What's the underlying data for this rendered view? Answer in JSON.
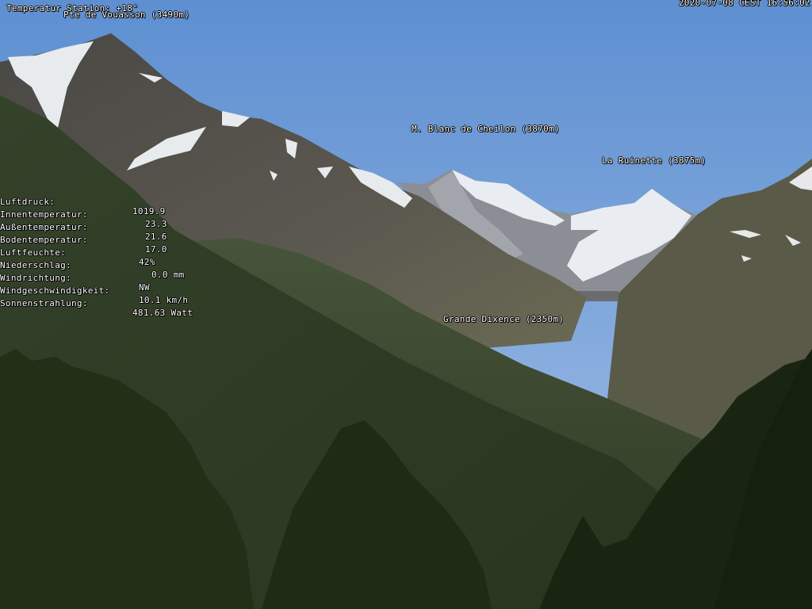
{
  "header": {
    "station_temp": "Temperatur Station: +18°",
    "timestamp": "2020-07-08 CEST 16:56:02"
  },
  "peaks": {
    "vouasson": "Pte de Vouasson (3490m)",
    "cheilon": "M. Blanc de Cheilon (3870m)",
    "ruinette": "La Ruinette (3875m)",
    "dixence": "Grande Dixence (2350m)"
  },
  "weather": [
    {
      "label": "Luftdruck:",
      "value": "1019.9"
    },
    {
      "label": "Innentemperatur:",
      "value": "23.3"
    },
    {
      "label": "Außentemperatur:",
      "value": "21.6"
    },
    {
      "label": "Bodentemperatur:",
      "value": "17.0"
    },
    {
      "label": "Luftfeuchte:",
      "value": "42%"
    },
    {
      "label": "Niederschlag:",
      "value": "0.0 mm"
    },
    {
      "label": "Windrichtung:",
      "value": "NW"
    },
    {
      "label": "Windgeschwindigkeit:",
      "value": "10.1 km/h"
    },
    {
      "label": "Sonnenstrahlung:",
      "value": "481.63 Watt"
    }
  ],
  "colors": {
    "sky_top": "#5d8fd1",
    "sky_bottom": "#a9c4e6",
    "rock": "#5a5850",
    "snow": "#eef1f4",
    "forest_far": "#3c4a2c",
    "forest_near": "#273219"
  }
}
